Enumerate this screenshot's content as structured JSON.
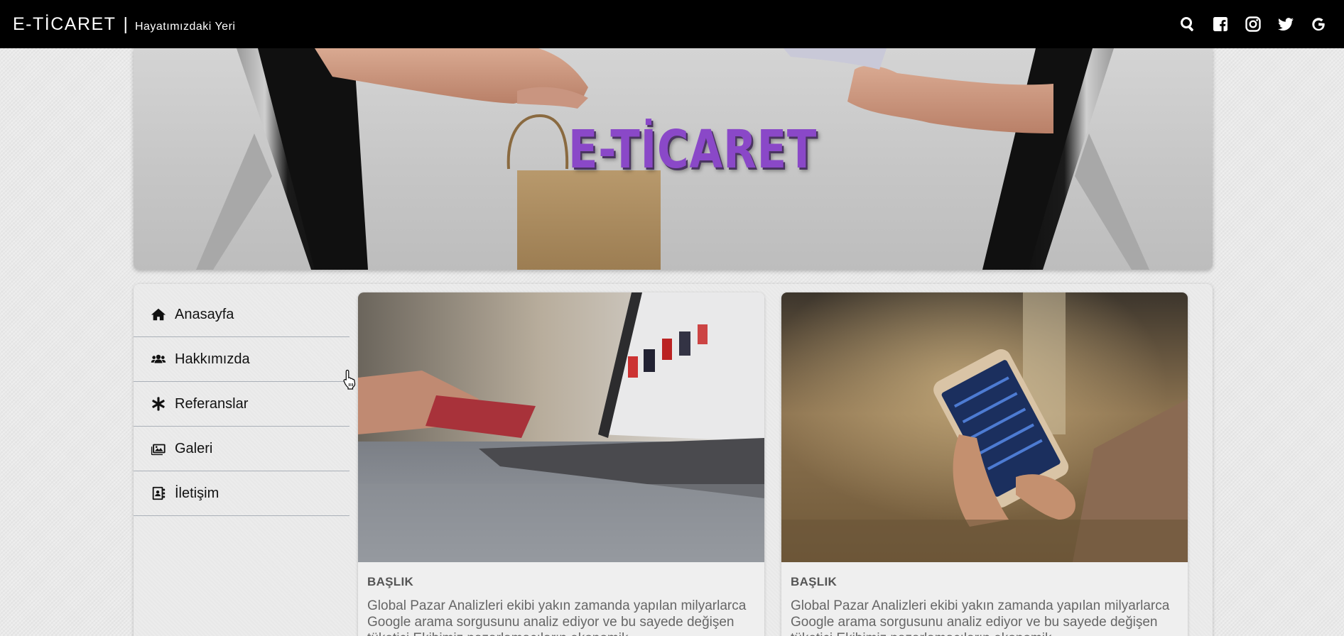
{
  "header": {
    "brand_title": "E-TİCARET",
    "brand_separator": "|",
    "brand_subtitle": "Hayatımızdaki Yeri",
    "icons": [
      "search-icon",
      "facebook-icon",
      "instagram-icon",
      "twitter-icon",
      "google-icon"
    ]
  },
  "hero": {
    "title": "E-TİCARET"
  },
  "sidebar": {
    "items": [
      {
        "label": "Anasayfa",
        "icon": "home-icon"
      },
      {
        "label": "Hakkımızda",
        "icon": "users-icon"
      },
      {
        "label": "Referanslar",
        "icon": "asterisk-icon"
      },
      {
        "label": "Galeri",
        "icon": "images-icon"
      },
      {
        "label": "İletişim",
        "icon": "address-book-icon"
      }
    ]
  },
  "cards": [
    {
      "title": "BAŞLIK",
      "text": "Global Pazar Analizleri ekibi yakın zamanda yapılan milyarlarca Google arama sorgusunu analiz ediyor ve bu sayede değişen tüketici Ekibimiz pazarlamacıların ekonomik"
    },
    {
      "title": "BAŞLIK",
      "text": "Global Pazar Analizleri ekibi yakın zamanda yapılan milyarlarca Google arama sorgusunu analiz ediyor ve bu sayede değişen tüketici Ekibimiz pazarlamacıların ekonomik"
    }
  ],
  "colors": {
    "navbar": "#000000",
    "hero_title": "#8a48c8",
    "page_background": "#e7e7e7"
  }
}
